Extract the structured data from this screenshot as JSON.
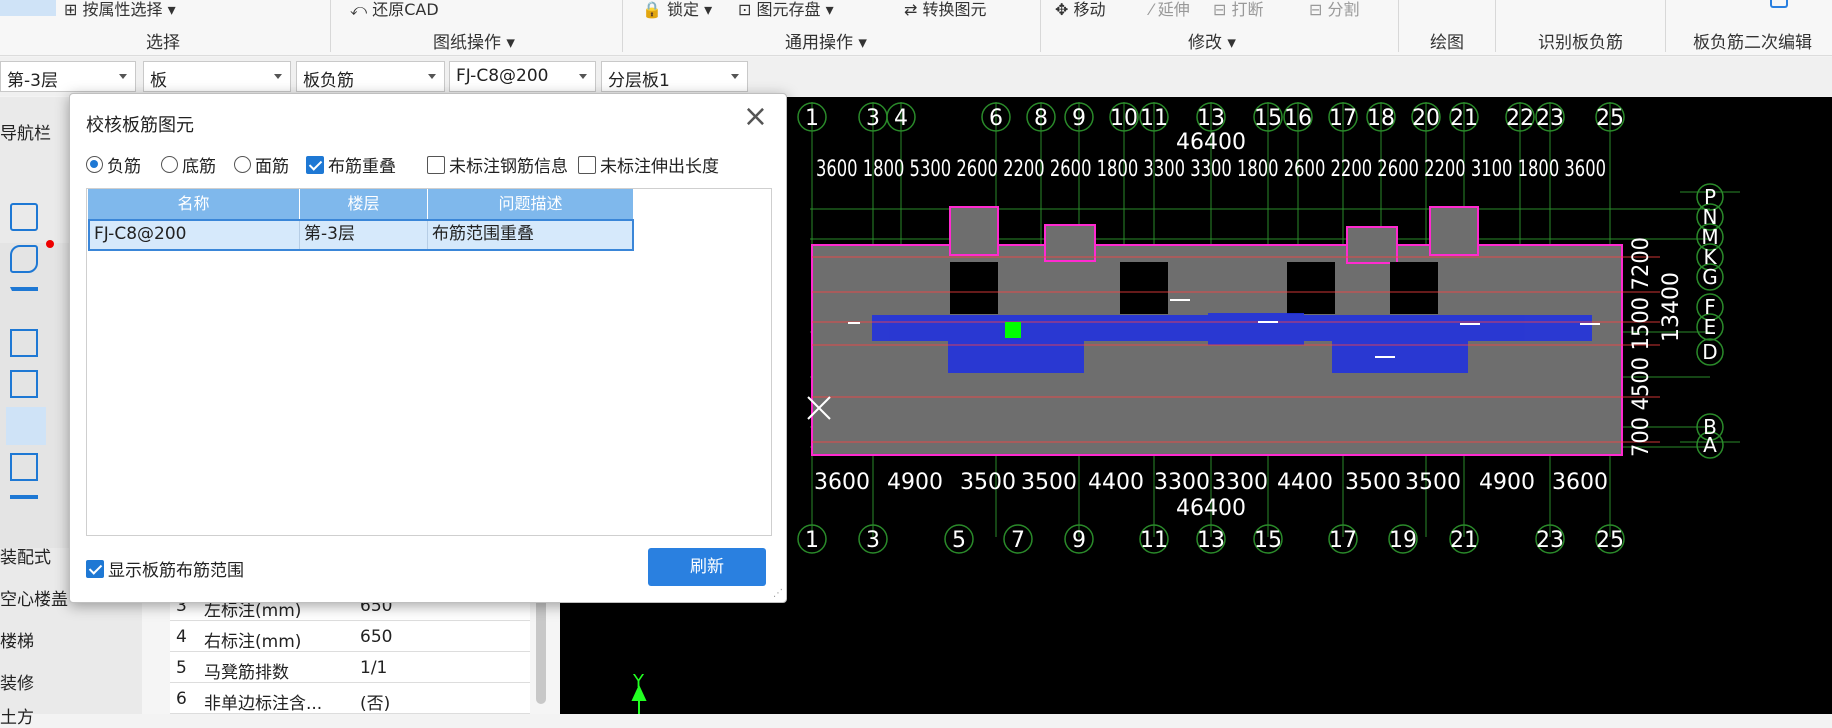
{
  "ribbon": {
    "items": [
      "按属性选择",
      "还原CAD",
      "锁定",
      "图元存盘",
      "转换图元",
      "移动",
      "延伸",
      "打断",
      "分割"
    ],
    "groups": [
      "选择",
      "图纸操作",
      "通用操作",
      "修改",
      "绘图",
      "识别板负筋",
      "板负筋二次编辑"
    ]
  },
  "selectors": [
    "第-3层",
    "板",
    "板负筋",
    "FJ-C8@200",
    "分层板1"
  ],
  "nav": {
    "title": "导航栏",
    "items": [
      "装配式",
      "空心楼盖",
      "楼梯",
      "装修",
      "土方"
    ]
  },
  "props": {
    "rows": [
      {
        "no": "3",
        "name": "左标注(mm)",
        "value": "650"
      },
      {
        "no": "4",
        "name": "右标注(mm)",
        "value": "650"
      },
      {
        "no": "5",
        "name": "马凳筋排数",
        "value": "1/1"
      },
      {
        "no": "6",
        "name": "非单边标注含...",
        "value": "(否)"
      }
    ]
  },
  "dialog": {
    "title": "校核板筋图元",
    "close": "×",
    "options": [
      {
        "label": "负筋",
        "type": "radio",
        "checked": true
      },
      {
        "label": "底筋",
        "type": "radio",
        "checked": false
      },
      {
        "label": "面筋",
        "type": "radio",
        "checked": false
      },
      {
        "label": "布筋重叠",
        "type": "checkbox",
        "checked": true
      },
      {
        "label": "未标注钢筋信息",
        "type": "checkbox",
        "checked": false
      },
      {
        "label": "未标注伸出长度",
        "type": "checkbox",
        "checked": false
      }
    ],
    "table": {
      "headers": [
        "名称",
        "楼层",
        "问题描述"
      ],
      "rows": [
        [
          "FJ-C8@200",
          "第-3层",
          "布筋范围重叠"
        ]
      ]
    },
    "show_range_label": "显示板筋布筋范围",
    "refresh_label": "刷新"
  },
  "drawing": {
    "top_axes": [
      "1",
      "3",
      "4",
      "6",
      "8",
      "9",
      "10",
      "11",
      "13",
      "15",
      "16",
      "17",
      "18",
      "20",
      "21",
      "22",
      "23",
      "25"
    ],
    "bottom_axes": [
      "1",
      "3",
      "5",
      "7",
      "9",
      "11",
      "13",
      "15",
      "17",
      "19",
      "21",
      "23",
      "25"
    ],
    "total_top": "46400",
    "total_bottom": "46400",
    "top_dims": "3600 1800 5300 2600 2200 2600 1800 3300 3300 1800 2600 2200 2600 2200 3100 1800 3600",
    "bottom_dims": [
      "3600",
      "4900",
      "3500",
      "3500",
      "4400",
      "3300",
      "3300",
      "4400",
      "3500",
      "3500",
      "4900",
      "3600"
    ],
    "right_total": "13400",
    "right_dims": "700 4500 1500 7200",
    "right_axes": [
      "P",
      "N",
      "M",
      "K",
      "G",
      "F",
      "E",
      "D",
      "B",
      "A"
    ],
    "y_axis": "Y"
  }
}
